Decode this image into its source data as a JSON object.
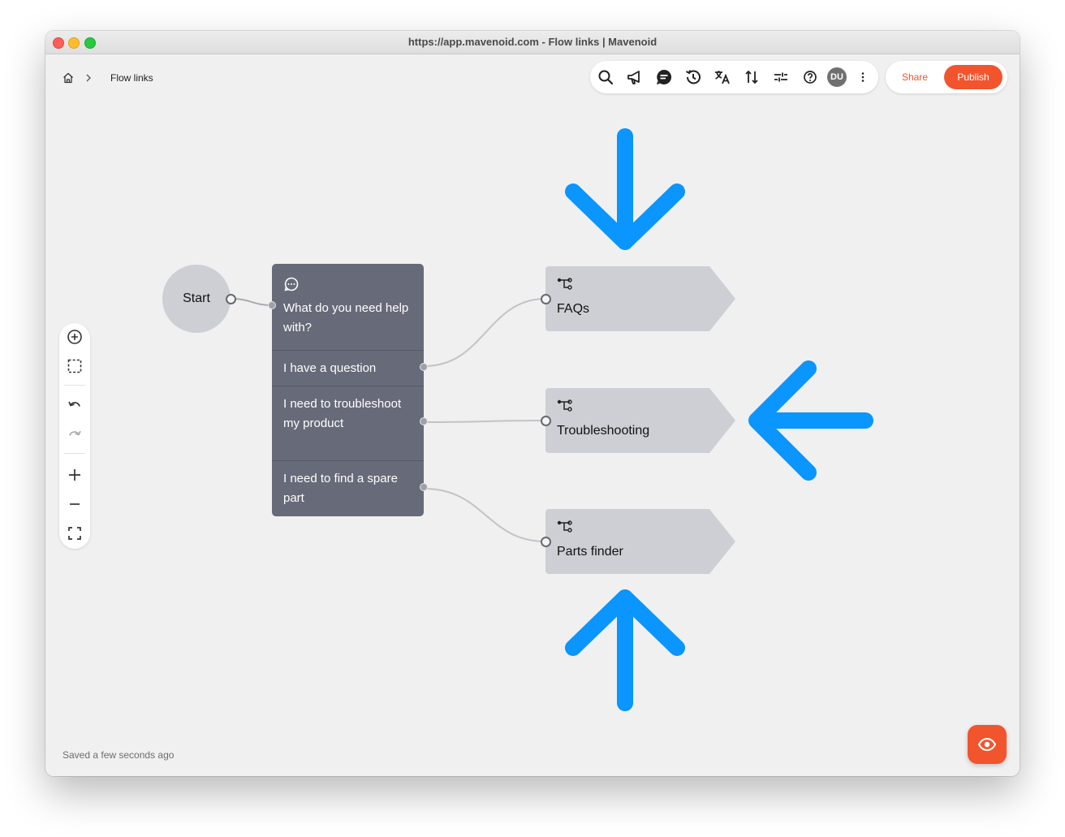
{
  "window": {
    "title": "https://app.mavenoid.com - Flow links | Mavenoid"
  },
  "breadcrumb": {
    "home_icon": "home-icon",
    "separator_icon": "chevron-right-icon",
    "current": "Flow links"
  },
  "toolbar": {
    "icons": [
      "search-icon",
      "megaphone-icon",
      "chat-icon",
      "history-icon",
      "translate-icon",
      "sort-icon",
      "settings-sliders-icon",
      "help-icon",
      "more-icon"
    ],
    "avatar_initials": "DU"
  },
  "actions": {
    "share_label": "Share",
    "publish_label": "Publish",
    "accent_color": "#f2542d"
  },
  "left_toolbar": {
    "icons": [
      "add-circle-icon",
      "select-area-icon",
      "undo-icon",
      "redo-icon",
      "zoom-in-icon",
      "zoom-out-icon",
      "fit-screen-icon"
    ]
  },
  "flow": {
    "start_label": "Start",
    "question": {
      "icon": "chat-bubble-icon",
      "text": "What do you need help with?",
      "options": [
        "I have a question",
        "I need to troubleshoot my product",
        "I need to find a spare part"
      ]
    },
    "targets": [
      {
        "icon": "flow-link-icon",
        "label": "FAQs"
      },
      {
        "icon": "flow-link-icon",
        "label": "Troubleshooting"
      },
      {
        "icon": "flow-link-icon",
        "label": "Parts finder"
      }
    ],
    "annotation_color": "#0a95ff"
  },
  "status": {
    "saved_text": "Saved a few seconds ago"
  },
  "preview": {
    "icon": "eye-icon"
  }
}
